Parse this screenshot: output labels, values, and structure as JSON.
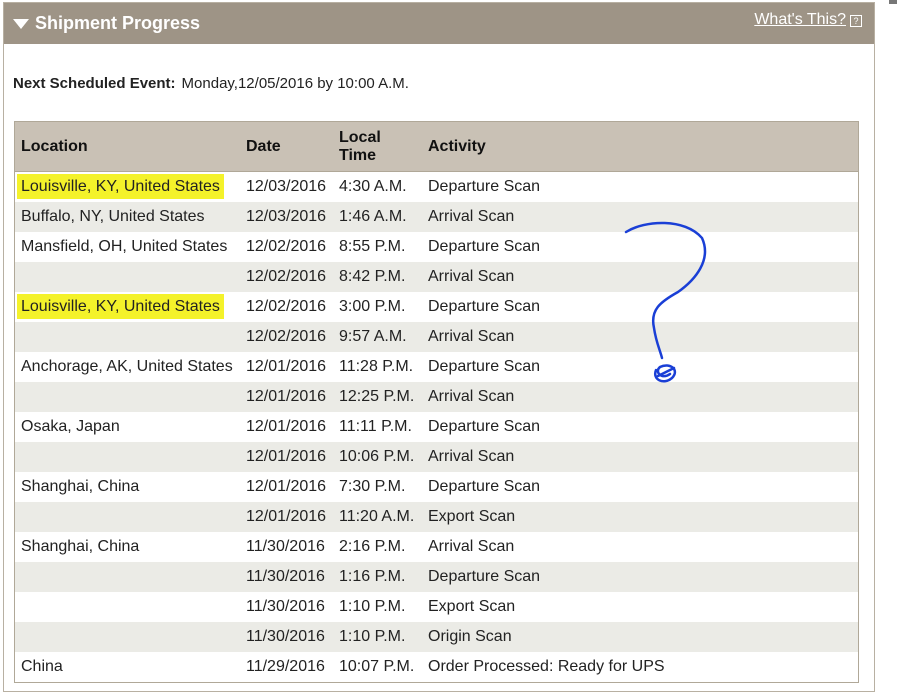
{
  "header": {
    "title": "Shipment Progress",
    "whats_this": "What's This?",
    "help_glyph": "?"
  },
  "next_event": {
    "label": "Next Scheduled Event:",
    "value": "Monday,12/05/2016 by 10:00 A.M."
  },
  "table": {
    "columns": [
      "Location",
      "Date",
      "Local Time",
      "Activity"
    ],
    "rows": [
      {
        "location": "Louisville, KY, United States",
        "date": "12/03/2016",
        "time": "4:30 A.M.",
        "activity": "Departure Scan",
        "highlight": true
      },
      {
        "location": "Buffalo, NY, United States",
        "date": "12/03/2016",
        "time": "1:46 A.M.",
        "activity": "Arrival Scan"
      },
      {
        "location": "Mansfield, OH, United States",
        "date": "12/02/2016",
        "time": "8:55 P.M.",
        "activity": "Departure Scan"
      },
      {
        "location": "",
        "date": "12/02/2016",
        "time": "8:42 P.M.",
        "activity": "Arrival Scan"
      },
      {
        "location": "Louisville, KY, United States",
        "date": "12/02/2016",
        "time": "3:00 P.M.",
        "activity": "Departure Scan",
        "highlight": true
      },
      {
        "location": "",
        "date": "12/02/2016",
        "time": "9:57 A.M.",
        "activity": "Arrival Scan"
      },
      {
        "location": "Anchorage, AK, United States",
        "date": "12/01/2016",
        "time": "11:28 P.M.",
        "activity": "Departure Scan"
      },
      {
        "location": "",
        "date": "12/01/2016",
        "time": "12:25 P.M.",
        "activity": "Arrival Scan"
      },
      {
        "location": "Osaka, Japan",
        "date": "12/01/2016",
        "time": "11:11 P.M.",
        "activity": "Departure Scan"
      },
      {
        "location": "",
        "date": "12/01/2016",
        "time": "10:06 P.M.",
        "activity": "Arrival Scan"
      },
      {
        "location": "Shanghai, China",
        "date": "12/01/2016",
        "time": "7:30 P.M.",
        "activity": "Departure Scan"
      },
      {
        "location": "",
        "date": "12/01/2016",
        "time": "11:20 A.M.",
        "activity": "Export Scan"
      },
      {
        "location": "Shanghai, China",
        "date": "11/30/2016",
        "time": "2:16 P.M.",
        "activity": "Arrival Scan"
      },
      {
        "location": "",
        "date": "11/30/2016",
        "time": "1:16 P.M.",
        "activity": "Departure Scan"
      },
      {
        "location": "",
        "date": "11/30/2016",
        "time": "1:10 P.M.",
        "activity": "Export Scan"
      },
      {
        "location": "",
        "date": "11/30/2016",
        "time": "1:10 P.M.",
        "activity": "Origin Scan"
      },
      {
        "location": "China",
        "date": "11/29/2016",
        "time": "10:07 P.M.",
        "activity": "Order Processed: Ready for UPS"
      }
    ]
  },
  "colors": {
    "header_bg": "#9e9486",
    "table_header_bg": "#c9c1b5",
    "stripe": "#ebebe6",
    "highlight": "#f4f22a",
    "annotation": "#1a3fd6"
  },
  "annotation": {
    "icon": "question-mark-scribble-icon"
  }
}
